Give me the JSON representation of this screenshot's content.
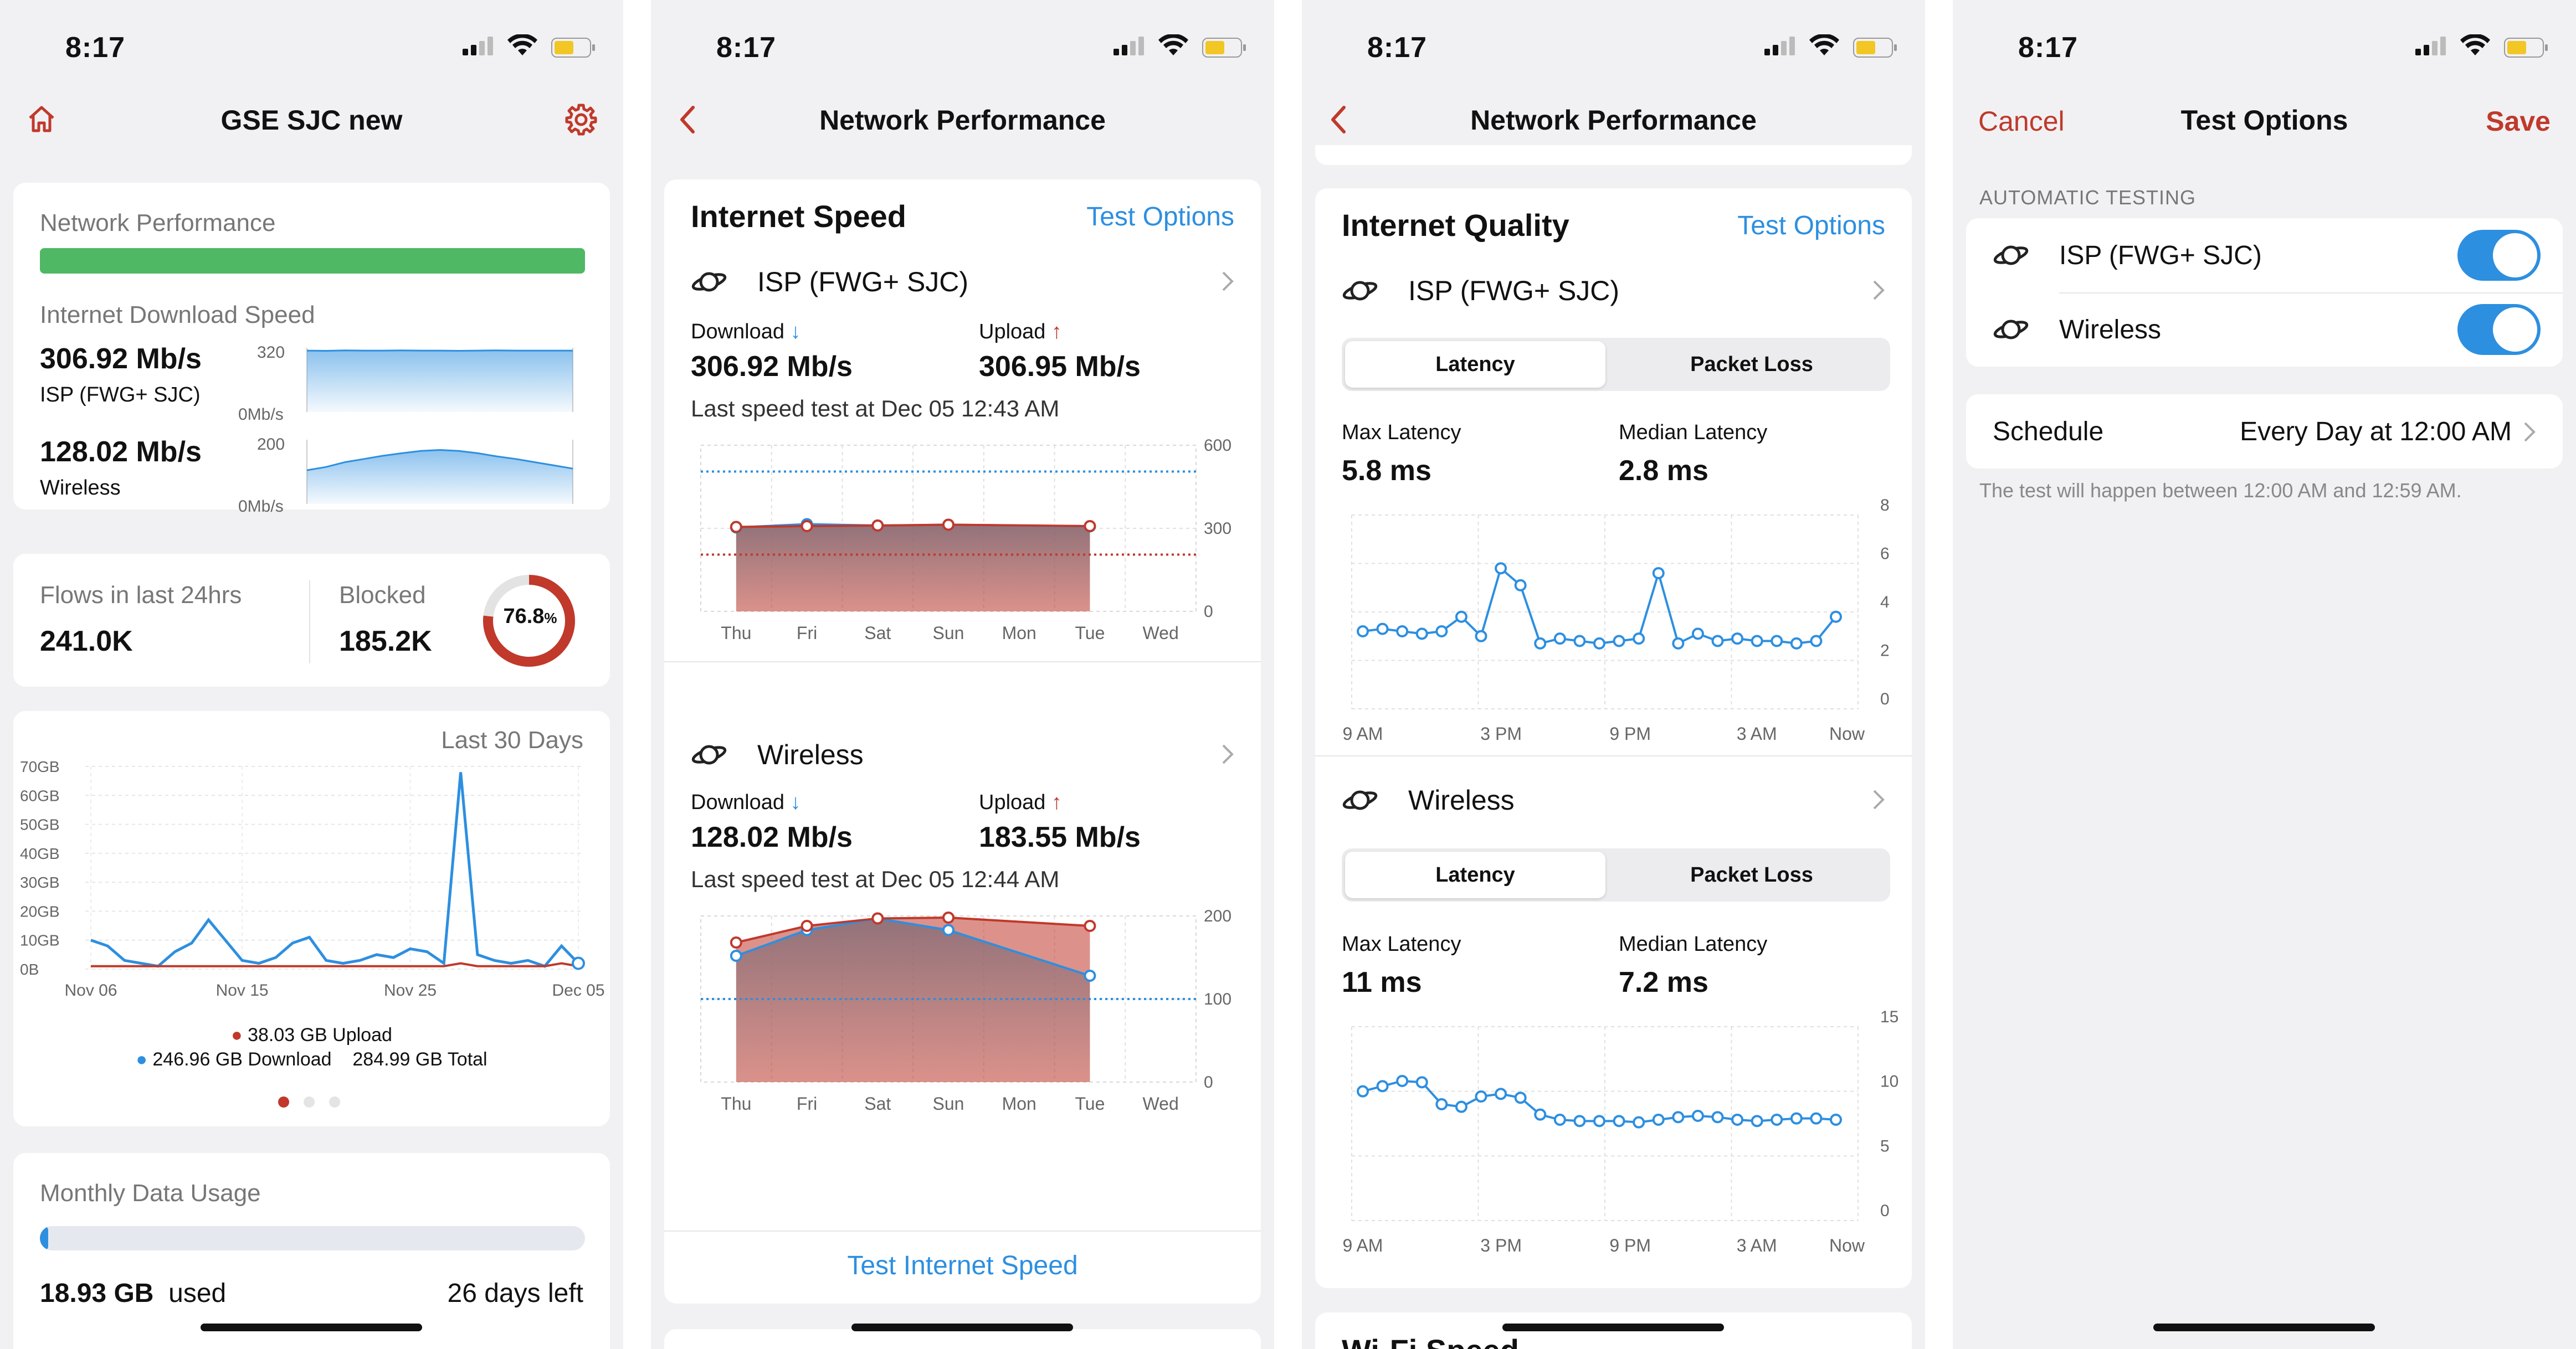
{
  "status_time": "8:17",
  "colors": {
    "accent_red": "#c0392b",
    "accent_blue": "#2d8fe0",
    "green": "#4fb865",
    "card_bg": "#ffffff",
    "page_bg": "#f1f1f3"
  },
  "screen1": {
    "nav_title": "GSE SJC new",
    "perf_label": "Network Performance",
    "download_label": "Internet Download Speed",
    "isp_speed": "306.92 Mb/s",
    "isp_name": "ISP (FWG+ SJC)",
    "isp_axis_top": "320",
    "isp_axis_bottom": "0Mb/s",
    "wireless_speed": "128.02 Mb/s",
    "wireless_name": "Wireless",
    "wireless_axis_top": "200",
    "wireless_axis_bottom": "0Mb/s",
    "flows_label": "Flows in last 24hrs",
    "flows_value": "241.0K",
    "blocked_label": "Blocked",
    "blocked_value": "185.2K",
    "blocked_percent": "76.8",
    "blocked_percent_sign": "%",
    "blocked_fraction": 0.768,
    "usage_period": "Last 30 Days",
    "usage_y_ticks": [
      "70GB",
      "60GB",
      "50GB",
      "40GB",
      "30GB",
      "20GB",
      "10GB",
      "0B"
    ],
    "usage_x_ticks": [
      "Nov 06",
      "Nov 15",
      "Nov 25",
      "Dec 05"
    ],
    "legend_upload": "38.03 GB Upload",
    "legend_download": "246.96 GB Download",
    "legend_total": "284.99 GB Total",
    "monthly_label": "Monthly Data Usage",
    "monthly_used_value": "18.93 GB",
    "monthly_used_word": "used",
    "monthly_days_left": "26 days left",
    "monthly_fraction": 0.015
  },
  "screen2": {
    "nav_title": "Network Performance",
    "section_title": "Internet Speed",
    "test_options": "Test Options",
    "isp": {
      "name": "ISP (FWG+ SJC)",
      "download_label": "Download",
      "download_value": "306.92 Mb/s",
      "upload_label": "Upload",
      "upload_value": "306.95 Mb/s",
      "last_test": "Last speed test at Dec 05 12:43 AM",
      "y_ticks": [
        "600",
        "300",
        "0"
      ]
    },
    "wireless": {
      "name": "Wireless",
      "download_label": "Download",
      "download_value": "128.02 Mb/s",
      "upload_label": "Upload",
      "upload_value": "183.55 Mb/s",
      "last_test": "Last speed test at Dec 05 12:44 AM",
      "y_ticks": [
        "200",
        "100",
        "0"
      ]
    },
    "x_ticks": [
      "Thu",
      "Fri",
      "Sat",
      "Sun",
      "Mon",
      "Tue",
      "Wed"
    ],
    "test_button": "Test Internet Speed"
  },
  "screen3": {
    "nav_title": "Network Performance",
    "section_title": "Internet Quality",
    "test_options": "Test Options",
    "isp": {
      "name": "ISP (FWG+ SJC)",
      "tab_latency": "Latency",
      "tab_packet_loss": "Packet Loss",
      "max_label": "Max Latency",
      "max_value": "5.8 ms",
      "median_label": "Median Latency",
      "median_value": "2.8 ms",
      "y_ticks": [
        "8",
        "6",
        "4",
        "2",
        "0"
      ]
    },
    "wireless": {
      "name": "Wireless",
      "tab_latency": "Latency",
      "tab_packet_loss": "Packet Loss",
      "max_label": "Max Latency",
      "max_value": "11 ms",
      "median_label": "Median Latency",
      "median_value": "7.2 ms",
      "y_ticks": [
        "15",
        "10",
        "5",
        "0"
      ]
    },
    "x_ticks": [
      "9 AM",
      "3 PM",
      "9 PM",
      "3 AM",
      "Now"
    ],
    "next_section_partial": "Wi-Fi Speed"
  },
  "screen4": {
    "cancel": "Cancel",
    "nav_title": "Test Options",
    "save": "Save",
    "section_header": "AUTOMATIC TESTING",
    "items": [
      {
        "label": "ISP (FWG+ SJC)",
        "enabled": true
      },
      {
        "label": "Wireless",
        "enabled": true
      }
    ],
    "schedule_label": "Schedule",
    "schedule_value": "Every Day at 12:00 AM",
    "note": "The test will happen between 12:00 AM and 12:59 AM."
  },
  "chart_data": [
    {
      "type": "area",
      "screen": "screen1",
      "series": [
        {
          "name": "ISP (FWG+ SJC)",
          "values": [
            306,
            305,
            307,
            306,
            306,
            307,
            306,
            306,
            305,
            306,
            307,
            306,
            306,
            306,
            306
          ]
        }
      ],
      "ylim": [
        0,
        320
      ]
    },
    {
      "type": "area",
      "screen": "screen1",
      "series": [
        {
          "name": "Wireless",
          "values": [
            105,
            115,
            130,
            140,
            150,
            158,
            165,
            168,
            165,
            158,
            148,
            140,
            130,
            120,
            110
          ]
        }
      ],
      "ylim": [
        0,
        200
      ]
    },
    {
      "type": "line",
      "screen": "screen1",
      "x": [
        "Nov 06",
        "Nov 07",
        "Nov 08",
        "Nov 09",
        "Nov 10",
        "Nov 11",
        "Nov 12",
        "Nov 13",
        "Nov 14",
        "Nov 15",
        "Nov 16",
        "Nov 17",
        "Nov 18",
        "Nov 19",
        "Nov 20",
        "Nov 21",
        "Nov 22",
        "Nov 23",
        "Nov 24",
        "Nov 25",
        "Nov 26",
        "Nov 27",
        "Nov 28",
        "Nov 29",
        "Nov 30",
        "Dec 01",
        "Dec 02",
        "Dec 03",
        "Dec 04",
        "Dec 05"
      ],
      "series": [
        {
          "name": "Download",
          "values": [
            10,
            8,
            3,
            2,
            1,
            6,
            9,
            17,
            10,
            3,
            2,
            4,
            9,
            11,
            3,
            2,
            3,
            5,
            4,
            7,
            6,
            2,
            68,
            5,
            3,
            2,
            3,
            1,
            8,
            2
          ]
        },
        {
          "name": "Upload",
          "values": [
            1,
            1,
            1,
            1,
            1,
            1,
            1,
            1,
            1,
            1,
            1,
            1,
            1,
            1,
            1,
            1,
            1,
            1,
            1,
            1,
            1,
            1,
            2,
            1,
            1,
            1,
            1,
            1,
            2,
            1
          ]
        }
      ],
      "ylim": [
        0,
        70
      ]
    },
    {
      "type": "area",
      "screen": "screen2",
      "categories": [
        "Thu",
        "Fri",
        "Sat",
        "Sun",
        "Mon",
        "Tue",
        "Wed"
      ],
      "series": [
        {
          "name": "Download",
          "values": [
            303,
            315,
            310,
            313,
            null,
            307,
            null
          ]
        },
        {
          "name": "Upload",
          "values": [
            305,
            308,
            310,
            313,
            null,
            308,
            null
          ]
        }
      ],
      "reference_lines": [
        {
          "name": "blue",
          "value": 505
        },
        {
          "name": "red",
          "value": 205
        }
      ],
      "ylim": [
        0,
        600
      ]
    },
    {
      "type": "area",
      "screen": "screen2",
      "categories": [
        "Thu",
        "Fri",
        "Sat",
        "Sun",
        "Mon",
        "Tue",
        "Wed"
      ],
      "series": [
        {
          "name": "Download",
          "values": [
            152,
            183,
            197,
            183,
            null,
            128,
            null
          ]
        },
        {
          "name": "Upload",
          "values": [
            168,
            188,
            197,
            198,
            null,
            188,
            null
          ]
        }
      ],
      "reference_lines": [
        {
          "name": "blue",
          "value": 100
        }
      ],
      "ylim": [
        0,
        200
      ]
    },
    {
      "type": "line",
      "screen": "screen3",
      "series": [
        {
          "name": "ISP latency",
          "values": [
            3.2,
            3.3,
            3.2,
            3.1,
            3.2,
            3.8,
            3.0,
            5.8,
            5.1,
            2.7,
            2.9,
            2.8,
            2.7,
            2.8,
            2.9,
            5.6,
            2.7,
            3.1,
            2.8,
            2.9,
            2.8,
            2.8,
            2.7,
            2.8,
            3.8
          ]
        }
      ],
      "ylim": [
        0,
        8
      ]
    },
    {
      "type": "line",
      "screen": "screen3",
      "series": [
        {
          "name": "Wireless latency",
          "values": [
            10,
            10.4,
            10.8,
            10.7,
            9,
            8.8,
            9.6,
            9.8,
            9.5,
            8.2,
            7.8,
            7.7,
            7.7,
            7.7,
            7.6,
            7.8,
            8.0,
            8.1,
            8.0,
            7.8,
            7.7,
            7.8,
            7.9,
            7.9,
            7.8
          ]
        }
      ],
      "ylim": [
        0,
        15
      ]
    }
  ]
}
